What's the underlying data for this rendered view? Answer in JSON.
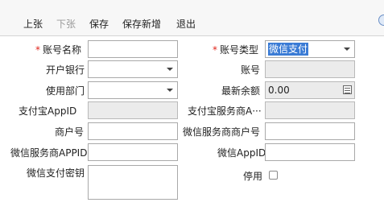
{
  "toolbar": {
    "prev": "上张",
    "next": "下张",
    "save": "保存",
    "save_new": "保存新增",
    "exit": "退出"
  },
  "required_mark": "*",
  "form": {
    "account_name_label": "账号名称",
    "account_type_label": "账号类型",
    "account_type_value": "微信支付",
    "bank_label": "开户银行",
    "account_no_label": "账号",
    "department_label": "使用部门",
    "balance_label": "最新余额",
    "balance_value": "0.00",
    "alipay_appid_label": "支付宝AppID",
    "alipay_provider_label": "支付宝服务商A···",
    "merchant_no_label": "商户号",
    "wechat_provider_merchant_label": "微信服务商商户号",
    "wechat_provider_appid_label": "微信服务商APPID",
    "wechat_appid_label": "微信AppID",
    "wechat_key_label": "微信支付密钥",
    "disabled_label": "停用"
  }
}
